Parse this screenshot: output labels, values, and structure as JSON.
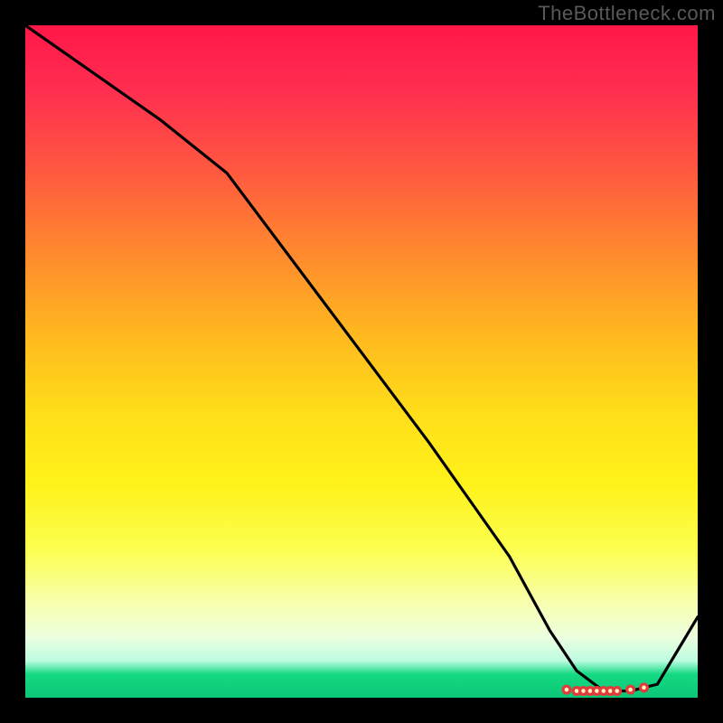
{
  "watermark": "TheBottleneck.com",
  "chart_data": {
    "type": "line",
    "title": "",
    "xlabel": "",
    "ylabel": "",
    "xlim": [
      0,
      100
    ],
    "ylim": [
      0,
      100
    ],
    "grid": false,
    "series": [
      {
        "name": "curve",
        "color": "#000000",
        "x": [
          0,
          10,
          20,
          30,
          45,
          60,
          72,
          78,
          82,
          86,
          90,
          94,
          100
        ],
        "y": [
          100,
          93,
          86,
          78,
          58,
          38,
          21,
          10,
          4,
          1,
          1,
          2,
          12
        ]
      }
    ],
    "markers": {
      "color": "#e23a3a",
      "shape": "circle-open",
      "points": [
        {
          "x": 80.5,
          "y": 1.2
        },
        {
          "x": 82.0,
          "y": 1.0
        },
        {
          "x": 83.0,
          "y": 1.0
        },
        {
          "x": 84.0,
          "y": 1.0
        },
        {
          "x": 85.0,
          "y": 1.0
        },
        {
          "x": 86.0,
          "y": 1.0
        },
        {
          "x": 87.0,
          "y": 1.0
        },
        {
          "x": 88.0,
          "y": 1.0
        },
        {
          "x": 90.0,
          "y": 1.2
        },
        {
          "x": 92.0,
          "y": 1.5
        }
      ]
    },
    "annotations": []
  }
}
